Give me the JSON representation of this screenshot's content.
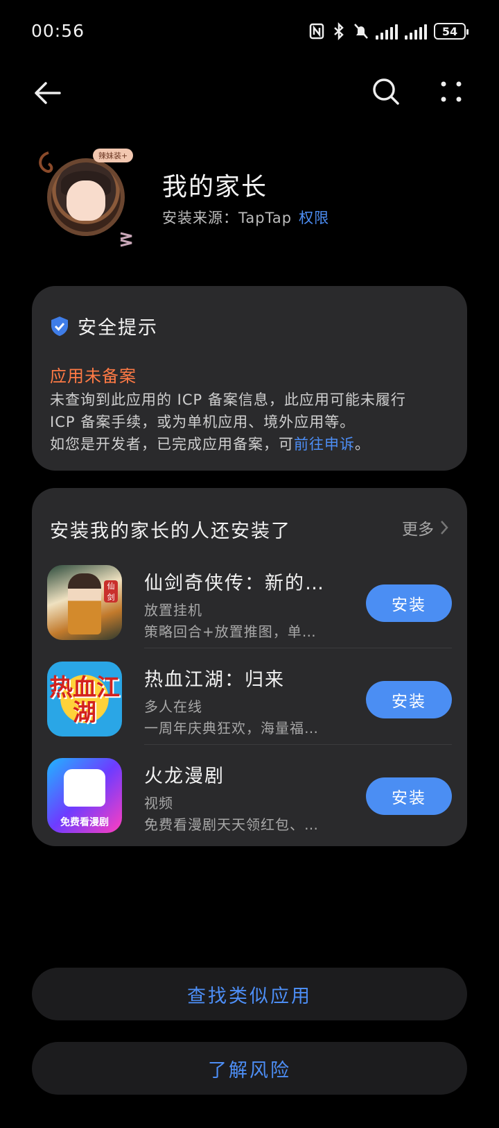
{
  "status_bar": {
    "time": "00:56",
    "battery": "54"
  },
  "app": {
    "name": "我的家长",
    "badge": "辣妹装+",
    "install_source": "安装来源：TapTap",
    "permissions_label": "权限"
  },
  "safety": {
    "title": "安全提示",
    "warning_heading": "应用未备案",
    "body_line1": "未查询到此应用的 ICP 备案信息，此应用可能未履行",
    "body_line2": "ICP 备案手续，或为单机应用、境外应用等。",
    "body_line3_prefix": "如您是开发者，已完成应用备案，可",
    "appeal_link": "前往申诉",
    "body_line3_suffix": "。"
  },
  "related": {
    "title": "安装我的家长的人还安装了",
    "more_label": "更多",
    "apps": [
      {
        "name": "仙剑奇侠传：新的…",
        "category": "放置挂机",
        "description": "策略回合+放置推图，单…",
        "install_label": "安装",
        "icon_seal": "仙剑"
      },
      {
        "name": "热血江湖：归来",
        "category": "多人在线",
        "description": "一周年庆典狂欢，海量福…",
        "install_label": "安装",
        "icon_text": "热血江湖"
      },
      {
        "name": "火龙漫剧",
        "category": "视频",
        "description": "免费看漫剧天天领红包、…",
        "install_label": "安装",
        "icon_text": "免费看漫剧"
      }
    ]
  },
  "actions": {
    "find_similar": "查找类似应用",
    "learn_risk": "了解风险"
  },
  "colors": {
    "accent": "#4b8ef3",
    "warning": "#ff7a45",
    "card_bg": "#2a2a2c"
  },
  "icons": {
    "back": "arrow-left-icon",
    "search": "search-icon",
    "more": "more-vertical-icon",
    "shield": "shield-check-icon",
    "chevron": "chevron-right-icon"
  }
}
